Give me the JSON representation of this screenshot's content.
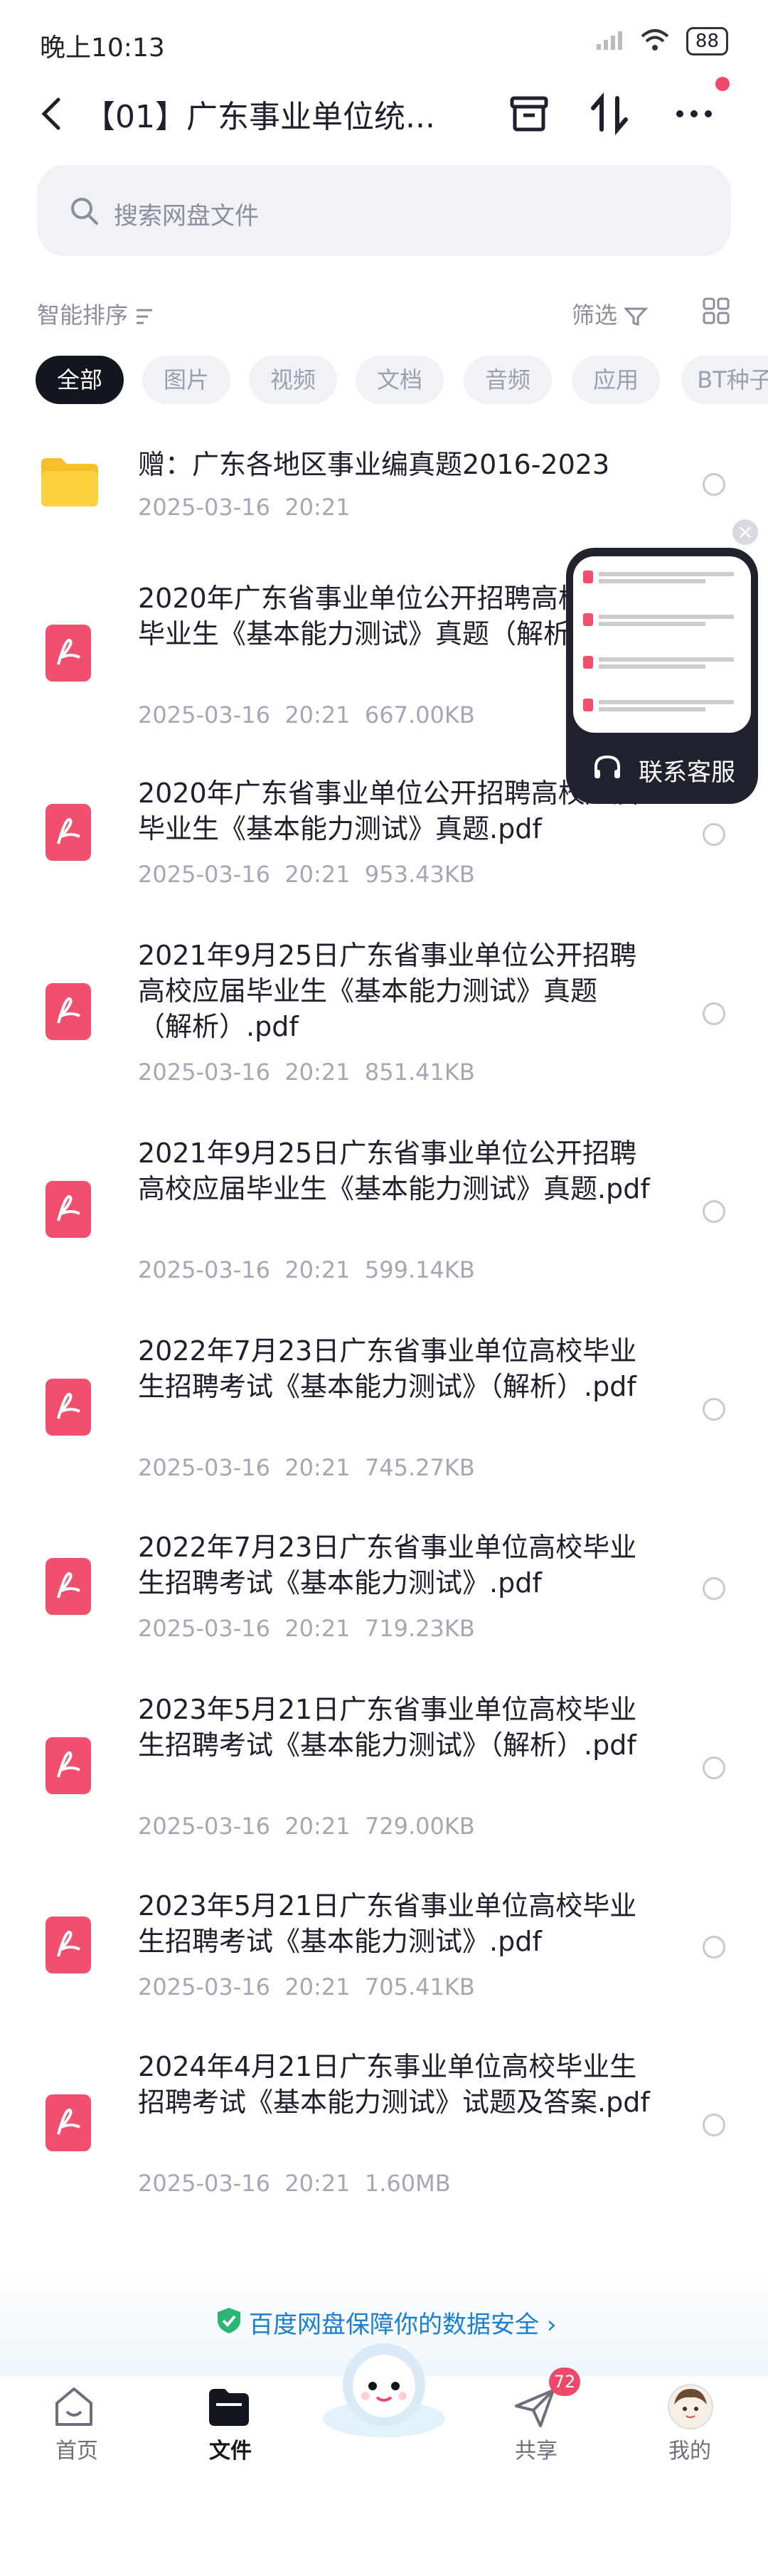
{
  "status": {
    "time": "晚上10:13",
    "battery": "88"
  },
  "header": {
    "title": "【01】广东事业单位统..."
  },
  "search": {
    "placeholder": "搜索网盘文件"
  },
  "sort": {
    "label": "智能排序",
    "filter": "筛选"
  },
  "chips": [
    "全部",
    "图片",
    "视频",
    "文档",
    "音频",
    "应用",
    "BT种子"
  ],
  "files": [
    {
      "name": "赠：广东各地区事业编真题2016-2023",
      "meta": "2025-03-16  20:21",
      "icon": "folder-icon"
    },
    {
      "name": "2020年广东省事业单位公开招聘高校应届毕业生《基本能力测试》真题（解析）.pdf",
      "meta": "2025-03-16  20:21  667.00KB",
      "icon": "pdf-icon"
    },
    {
      "name": "2020年广东省事业单位公开招聘高校应届毕业生《基本能力测试》真题.pdf",
      "meta": "2025-03-16  20:21  953.43KB",
      "icon": "pdf-icon"
    },
    {
      "name": "2021年9月25日广东省事业单位公开招聘高校应届毕业生《基本能力测试》真题（解析）.pdf",
      "meta": "2025-03-16  20:21  851.41KB",
      "icon": "pdf-icon"
    },
    {
      "name": "2021年9月25日广东省事业单位公开招聘高校应届毕业生《基本能力测试》真题.pdf",
      "meta": "2025-03-16  20:21  599.14KB",
      "icon": "pdf-icon"
    },
    {
      "name": "2022年7月23日广东省事业单位高校毕业生招聘考试《基本能力测试》（解析）.pdf",
      "meta": "2025-03-16  20:21  745.27KB",
      "icon": "pdf-icon"
    },
    {
      "name": "2022年7月23日广东省事业单位高校毕业生招聘考试《基本能力测试》.pdf",
      "meta": "2025-03-16  20:21  719.23KB",
      "icon": "pdf-icon"
    },
    {
      "name": "2023年5月21日广东省事业单位高校毕业生招聘考试《基本能力测试》（解析）.pdf",
      "meta": "2025-03-16  20:21  729.00KB",
      "icon": "pdf-icon"
    },
    {
      "name": "2023年5月21日广东省事业单位高校毕业生招聘考试《基本能力测试》.pdf",
      "meta": "2025-03-16  20:21  705.41KB",
      "icon": "pdf-icon"
    },
    {
      "name": "2024年4月21日广东事业单位高校毕业生招聘考试《基本能力测试》试题及答案.pdf",
      "meta": "2025-03-16  20:21  1.60MB",
      "icon": "pdf-icon"
    }
  ],
  "customer_service": {
    "label": "联系客服"
  },
  "banner": {
    "text": "百度网盘保障你的数据安全"
  },
  "nav": {
    "home": "首页",
    "files": "文件",
    "share": "共享",
    "me": "我的",
    "share_badge": "72"
  },
  "colors": {
    "accent": "#1a7fd0",
    "pdf": "#f0506e",
    "folder": "#f7bf2a",
    "badge": "#f0486a"
  }
}
